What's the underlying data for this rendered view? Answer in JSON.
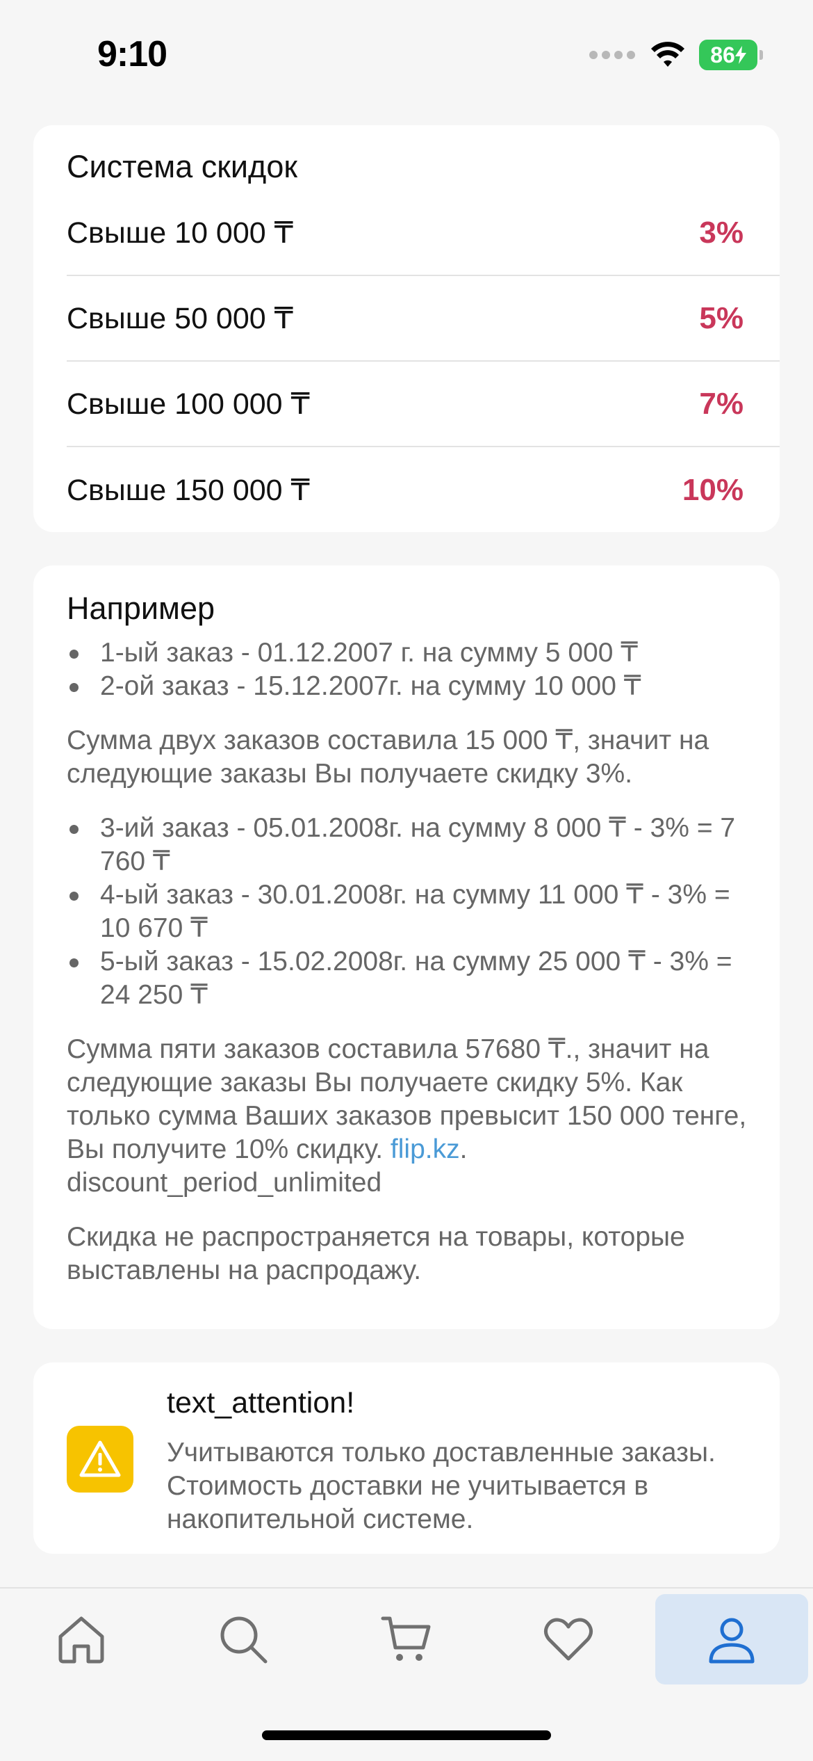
{
  "status_bar": {
    "time": "9:10",
    "battery": "86"
  },
  "discounts": {
    "title": "Система скидок",
    "rows": [
      {
        "label": "Свыше 10 000 ₸",
        "value": "3%"
      },
      {
        "label": "Свыше 50 000 ₸",
        "value": "5%"
      },
      {
        "label": "Свыше 100 000 ₸",
        "value": "7%"
      },
      {
        "label": "Свыше 150 000 ₸",
        "value": "10%"
      }
    ]
  },
  "example": {
    "title": "Например",
    "list1": [
      "1-ый заказ - 01.12.2007 г. на сумму 5 000 ₸",
      "2-ой заказ - 15.12.2007г. на сумму 10 000 ₸"
    ],
    "para1": "Сумма двух заказов составила 15 000 ₸, значит на следующие заказы Вы получаете скидку 3%.",
    "list2": [
      "3-ий заказ - 05.01.2008г. на сумму 8 000 ₸ - 3% = 7 760 ₸",
      "4-ый заказ - 30.01.2008г. на сумму 11 000 ₸ - 3% = 10 670 ₸",
      "5-ый заказ - 15.02.2008г. на сумму 25 000 ₸ - 3% = 24 250 ₸"
    ],
    "para2_before_link": "Сумма пяти заказов составила 57680 ₸., значит на следующие заказы Вы получаете скидку 5%. Как только сумма Ваших заказов превысит 150 000 тенге, Вы получите 10% скидку. ",
    "para2_link": "flip.kz",
    "para2_after_link": ".",
    "para2_key": "discount_period_unlimited",
    "para3": "Скидка не распространяется на товары, которые выставлены на распродажу."
  },
  "attention": {
    "title": "text_attention!",
    "text": "Учитываются только доставленные заказы. Стоимость доставки не учитывается в накопительной системе."
  },
  "tab_bar": {
    "items": [
      {
        "icon": "home-icon"
      },
      {
        "icon": "search-icon"
      },
      {
        "icon": "cart-icon"
      },
      {
        "icon": "heart-icon"
      },
      {
        "icon": "profile-icon",
        "active": true
      }
    ]
  },
  "colors": {
    "discount_accent": "#c9375a",
    "link": "#4a9ad6",
    "warning": "#f7c300",
    "active_tab_bg": "#d9e6f5",
    "active_tab_icon": "#1f6fd1"
  }
}
